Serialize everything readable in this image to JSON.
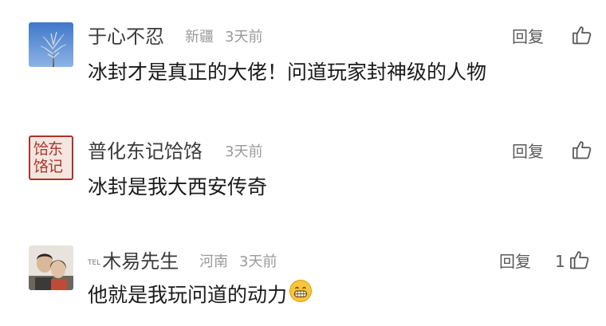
{
  "actions": {
    "reply_label": "回复"
  },
  "comments": [
    {
      "username": "于心不忍",
      "location": "新疆",
      "time": "3天前",
      "text": "冰封才是真正的大佬！问道玩家封神级的人物",
      "likes": ""
    },
    {
      "username": "普化东记饸饹",
      "location": "",
      "time": "3天前",
      "text": "冰封是我大西安传奇",
      "likes": "",
      "avatar_text": [
        "饸东",
        "饹记"
      ]
    },
    {
      "username_badge": "TEL",
      "username": "木易先生",
      "location": "河南",
      "time": "3天前",
      "text": "他就是我玩问道的动力",
      "likes": "1"
    }
  ],
  "icons": {
    "like": "thumbs-up-icon",
    "emoji": "grinning-face-emoji"
  },
  "colors": {
    "username": "#3a3a3a",
    "meta": "#9a9a9a",
    "text": "#1a1a1a",
    "avatar2_bg": "#f4e6de",
    "avatar2_border": "#a8342c"
  }
}
